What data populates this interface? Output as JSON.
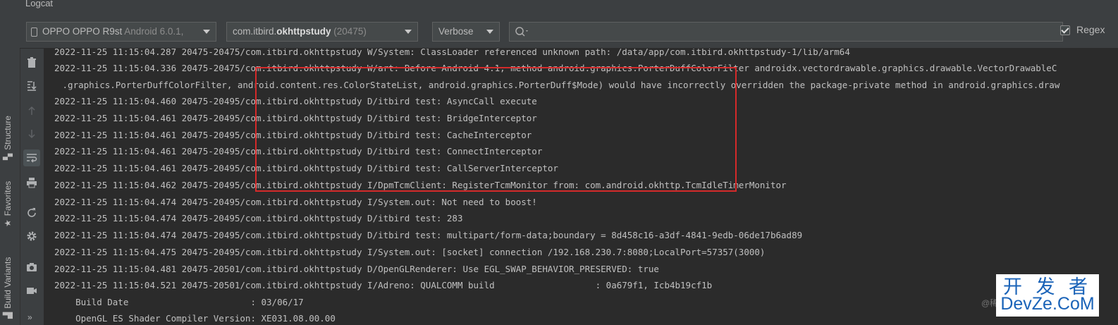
{
  "window": {
    "title": "Logcat"
  },
  "toolbar": {
    "device": {
      "name": "OPPO OPPO R9st",
      "os": "Android 6.0.1,"
    },
    "process": {
      "prefix": "com.itbird.",
      "bold": "okhttpstudy",
      "pid": "(20475)"
    },
    "level": "Verbose",
    "search": {
      "value": "",
      "placeholder": ""
    },
    "regex": {
      "label": "Regex",
      "checked": true
    }
  },
  "side_tabs": [
    "Structure",
    "Favorites",
    "Build Variants"
  ],
  "action_icons": [
    "trash-icon",
    "scroll-to-end-icon",
    "arrow-up-icon",
    "arrow-down-icon",
    "soft-wrap-icon",
    "print-icon",
    "restart-icon",
    "settings-icon",
    "camera-icon",
    "video-icon"
  ],
  "log_lines": [
    "2022-11-25 11:15:04.287 20475-20475/com.itbird.okhttpstudy W/System: ClassLoader referenced unknown path: /data/app/com.itbird.okhttpstudy-1/lib/arm64",
    "2022-11-25 11:15:04.336 20475-20475/com.itbird.okhttpstudy W/art: Before Android 4.1, method android.graphics.PorterDuffColorFilter androidx.vectordrawable.graphics.drawable.VectorDrawableC",
    " .graphics.PorterDuffColorFilter, android.content.res.ColorStateList, android.graphics.PorterDuff$Mode) would have incorrectly overridden the package-private method in android.graphics.draw",
    "2022-11-25 11:15:04.460 20475-20495/com.itbird.okhttpstudy D/itbird test: AsyncCall execute",
    "2022-11-25 11:15:04.461 20475-20495/com.itbird.okhttpstudy D/itbird test: BridgeInterceptor",
    "2022-11-25 11:15:04.461 20475-20495/com.itbird.okhttpstudy D/itbird test: CacheInterceptor",
    "2022-11-25 11:15:04.461 20475-20495/com.itbird.okhttpstudy D/itbird test: ConnectInterceptor",
    "2022-11-25 11:15:04.461 20475-20495/com.itbird.okhttpstudy D/itbird test: CallServerInterceptor",
    "2022-11-25 11:15:04.462 20475-20495/com.itbird.okhttpstudy I/DpmTcmClient: RegisterTcmMonitor from: com.android.okhttp.TcmIdleTimerMonitor",
    "2022-11-25 11:15:04.474 20475-20495/com.itbird.okhttpstudy I/System.out: Not need to boost!",
    "2022-11-25 11:15:04.474 20475-20495/com.itbird.okhttpstudy D/itbird test: 283",
    "2022-11-25 11:15:04.474 20475-20495/com.itbird.okhttpstudy D/itbird test: multipart/form-data;boundary = 8d458c16-a3df-4841-9edb-06de17b6ad89",
    "2022-11-25 11:15:04.475 20475-20495/com.itbird.okhttpstudy I/System.out: [socket] connection /192.168.230.7:8080;LocalPort=57357(3000)",
    "2022-11-25 11:15:04.481 20475-20501/com.itbird.okhttpstudy D/OpenGLRenderer: Use EGL_SWAP_BEHAVIOR_PRESERVED: true",
    "2022-11-25 11:15:04.521 20475-20501/com.itbird.okhttpstudy I/Adreno: QUALCOMM build                   : 0a679f1, Icb4b19cf1b",
    "    Build Date                       : 03/06/17",
    "    OpenGL ES Shader Compiler Version: XE031.08.00.00"
  ],
  "watermark": {
    "cn": "开 发 者",
    "en": "DevZe.CoM",
    "small": "@稀"
  },
  "colors": {
    "highlight_box": "#d42a2a",
    "background": "#2b2b2b",
    "panel": "#3c3f41"
  }
}
